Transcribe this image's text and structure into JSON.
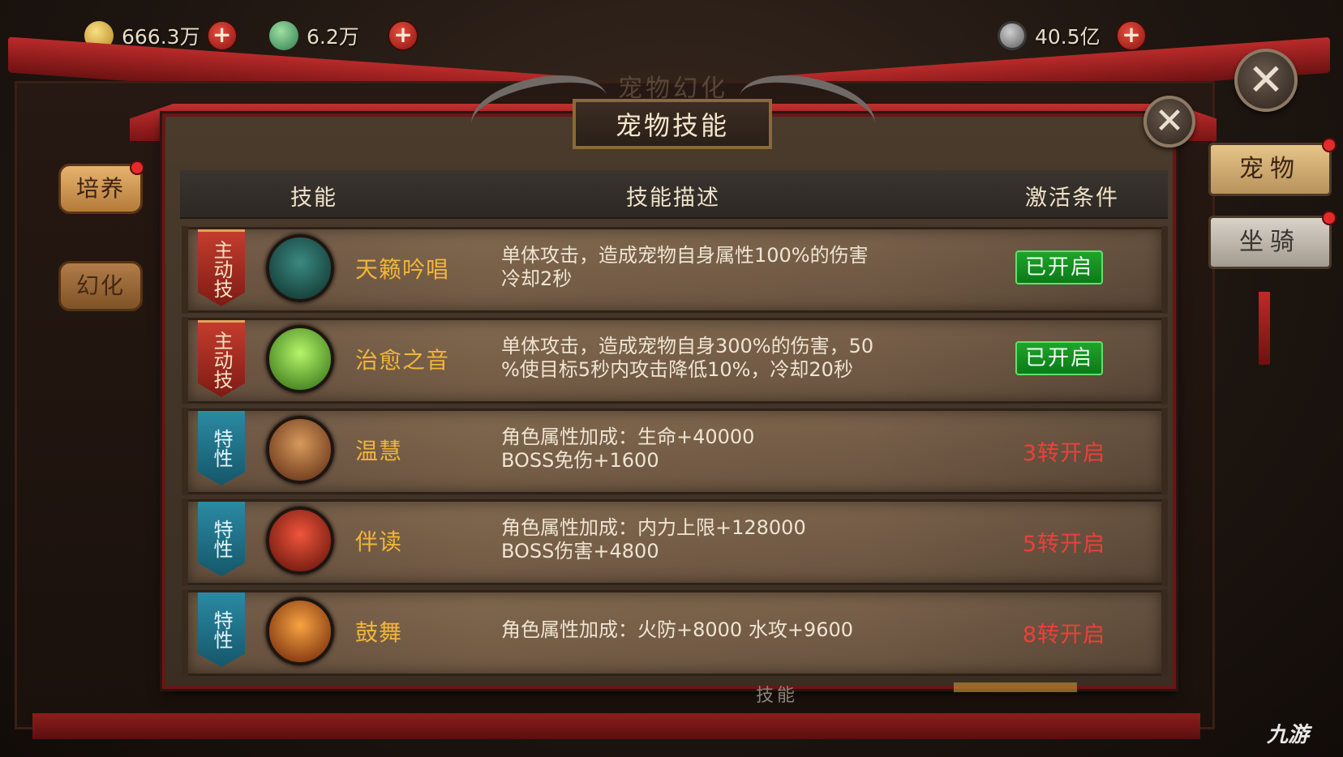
{
  "top_bar": {
    "currencies": [
      {
        "icon": "gold-ingot-icon",
        "value": "666.3万"
      },
      {
        "icon": "jade-icon",
        "value": "6.2万"
      },
      {
        "icon": "copper-coin-icon",
        "value": "40.5亿"
      }
    ]
  },
  "background_title": "宠物幻化",
  "panel": {
    "title": "宠物技能",
    "headers": {
      "skill": "技能",
      "desc": "技能描述",
      "condition": "激活条件"
    },
    "rows": [
      {
        "tag": "主动技",
        "tag_type": "active",
        "icon": "singing-girl-icon",
        "name": "天籁吟唱",
        "desc": "单体攻击，造成宠物自身属性100%的伤害\n冷却2秒",
        "status": "已开启",
        "status_type": "on"
      },
      {
        "tag": "主动技",
        "tag_type": "active",
        "icon": "healing-sound-icon",
        "name": "治愈之音",
        "desc": "单体攻击，造成宠物自身300%的伤害，50\n%使目标5秒内攻击降低10%，冷却20秒",
        "status": "已开启",
        "status_type": "on"
      },
      {
        "tag": "特性",
        "tag_type": "trait",
        "icon": "wisdom-figure-icon",
        "name": "温慧",
        "desc": "角色属性加成：生命+40000\nBOSS免伤+1600",
        "status": "3转开启",
        "status_type": "locked"
      },
      {
        "tag": "特性",
        "tag_type": "trait",
        "icon": "flexing-warrior-icon",
        "name": "伴读",
        "desc": "角色属性加成：内力上限+128000\nBOSS伤害+4800",
        "status": "5转开启",
        "status_type": "locked"
      },
      {
        "tag": "特性",
        "tag_type": "trait",
        "icon": "flame-dance-icon",
        "name": "鼓舞",
        "desc": "角色属性加成：火防+8000 水攻+9600",
        "status": "8转开启",
        "status_type": "locked"
      }
    ]
  },
  "left_tabs": [
    {
      "label": "培养",
      "active": true
    },
    {
      "label": "幻化",
      "active": false
    }
  ],
  "right_tabs": [
    {
      "label": "宠物"
    },
    {
      "label": "坐骑"
    }
  ],
  "bottom_label": "技能",
  "watermark": "九游",
  "colors": {
    "skill_name": "#f1b53a",
    "status_on": "#1fa42c",
    "status_locked": "#ee3f3a",
    "active_tag": "#c33c2e",
    "trait_tag": "#2b8aa3"
  }
}
